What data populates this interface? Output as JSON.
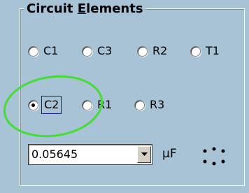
{
  "group": {
    "title_prefix": "Circuit ",
    "title_accel": "E",
    "title_suffix": "lements"
  },
  "radios": {
    "c1": {
      "label": "C1",
      "checked": false
    },
    "c3": {
      "label": "C3",
      "checked": false
    },
    "r2": {
      "label": "R2",
      "checked": false
    },
    "t1": {
      "label": "T1",
      "checked": false
    },
    "c2": {
      "label": "C2",
      "checked": true
    },
    "r1": {
      "label": "R1",
      "checked": false
    },
    "r3": {
      "label": "R3",
      "checked": false
    }
  },
  "value_field": {
    "value": "0.05645",
    "unit": "µF",
    "dropdown_icon": "triangle-down-icon"
  },
  "spinner_icon": "dots-grid-icon",
  "colors": {
    "background": "#a9c3d6",
    "annotation_circle": "#44dd33"
  }
}
